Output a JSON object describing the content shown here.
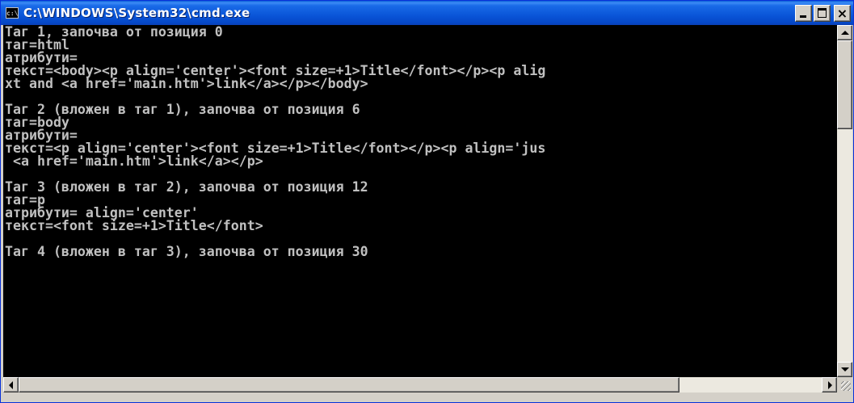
{
  "window": {
    "title": "C:\\WINDOWS\\System32\\cmd.exe",
    "icon_label": "c:\\",
    "icon": "console-icon",
    "buttons": {
      "minimize": "minimize-icon",
      "maximize": "maximize-icon",
      "close": "×"
    }
  },
  "console": {
    "text_color": "#c0c0c0",
    "background": "#000000",
    "lines": [
      "Таг 1, започва от позиция 0",
      "таг=html",
      "атрибути=",
      "текст=<body><p align='center'><font size=+1>Title</font></p><p alig",
      "xt and <a href='main.htm'>link</a></p></body>",
      "",
      "Таг 2 (вложен в таг 1), започва от позиция 6",
      "таг=body",
      "атрибути=",
      "текст=<p align='center'><font size=+1>Title</font></p><p align='jus",
      " <a href='main.htm'>link</a></p>",
      "",
      "Таг 3 (вложен в таг 2), започва от позиция 12",
      "таг=p",
      "атрибути= align='center'",
      "текст=<font size=+1>Title</font>",
      "",
      "Таг 4 (вложен в таг 3), започва от позиция 30"
    ]
  },
  "scrollbars": {
    "vertical": {
      "up": "arrow-up-icon",
      "down": "arrow-down-icon"
    },
    "horizontal": {
      "left": "arrow-left-icon",
      "right": "arrow-right-icon"
    }
  }
}
